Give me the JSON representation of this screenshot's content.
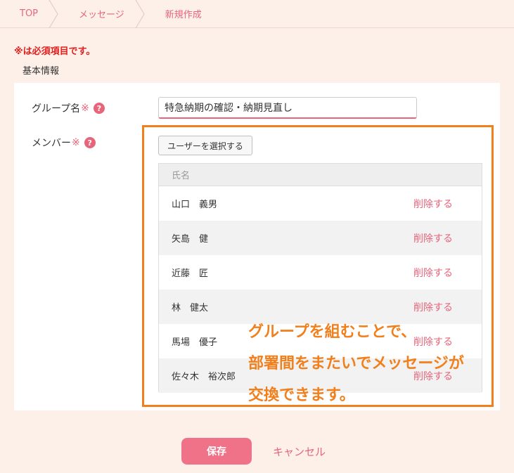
{
  "breadcrumb": {
    "items": [
      {
        "label": "TOP"
      },
      {
        "label": "メッセージ"
      },
      {
        "label": "新規作成"
      }
    ]
  },
  "form": {
    "required_note": "※は必須項目です。",
    "section_title": "基本情報",
    "group_name": {
      "label": "グループ名",
      "required_mark": "※",
      "help": "?",
      "value": "特急納期の確認・納期見直し"
    },
    "members": {
      "label": "メンバー",
      "required_mark": "※",
      "help": "?",
      "select_button": "ユーザーを選択する",
      "column_name": "氏名",
      "delete_label": "削除する",
      "rows": [
        {
          "name": "山口　義男"
        },
        {
          "name": "矢島　健"
        },
        {
          "name": "近藤　匠"
        },
        {
          "name": "林　健太"
        },
        {
          "name": "馬場　優子"
        },
        {
          "name": "佐々木　裕次郎"
        }
      ]
    }
  },
  "callout": {
    "lines": [
      "グループを組むことで、",
      "部署間をまたいでメッセージが",
      "交換できます。"
    ]
  },
  "actions": {
    "save": "保存",
    "cancel": "キャンセル"
  },
  "colors": {
    "background": "#fdf0e9",
    "accent_pink": "#e8647a",
    "highlight_orange": "#f07f1c",
    "required_red": "#e0201e"
  }
}
